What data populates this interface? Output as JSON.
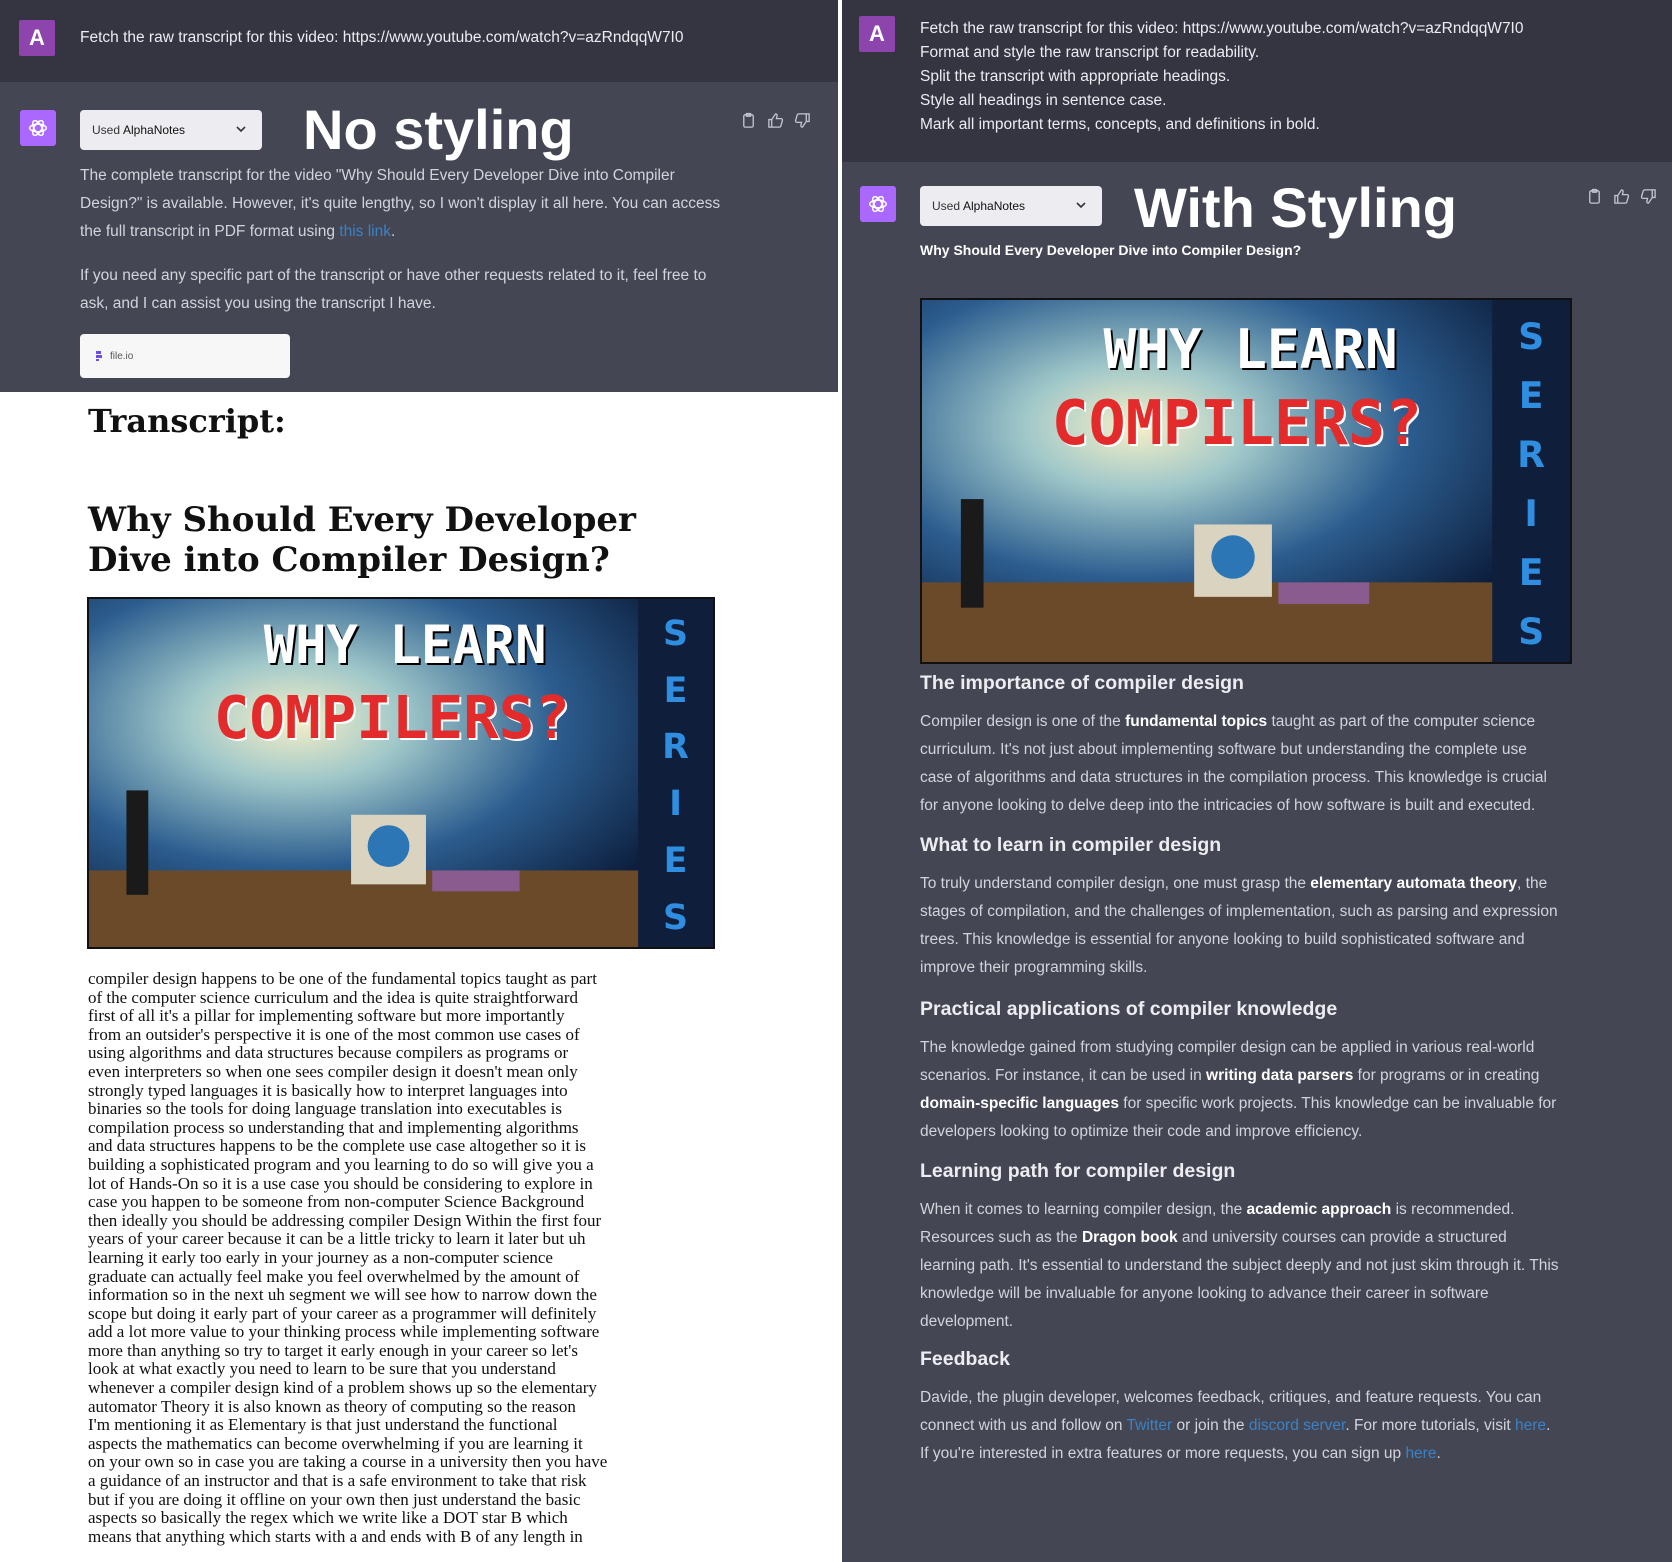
{
  "left": {
    "user_avatar_letter": "A",
    "user_message": "Fetch the raw transcript for this video: https://www.youtube.com/watch?v=azRndqqW7I0",
    "plugin_used_prefix": "Used ",
    "plugin_name": "AlphaNotes",
    "overlay_label": "No styling",
    "reply_p1_a": "The complete transcript for the video \"Why Should Every Developer Dive into Compiler Design?\" is available. However, it's quite lengthy, so I won't display it all here. You can access the full transcript in PDF format using ",
    "reply_p1_link": "this link",
    "reply_p1_b": ".",
    "reply_p2": "If you need any specific part of the transcript or have other requests related to it, feel free to ask, and I can assist you using the transcript I have.",
    "file_card_label": "file.io",
    "doc": {
      "heading": "Transcript:",
      "title": "Why Should Every Developer Dive into Compiler Design?",
      "thumb_line1": "WHY LEARN",
      "thumb_line2": "COMPILERS?",
      "thumb_series": "SERIES",
      "body": "compiler design happens to be one of the  fundamental topics taught as part\nof the   computer science curriculum and the idea is quite  straightforward\nfirst of all it's a pillar for   implementing software but more importantly\nfrom  an outsider's perspective it is one of the most   common use cases of\nusing algorithms and data  structures because compilers as programs or\neven interpreters so when one sees compiler  design it doesn't mean only\nstrongly typed   languages it is basically how to interpret  languages into\nbinaries so the tools for   doing language translation into executables  is\ncompilation process so understanding that   and implementing algorithms\nand data structures  happens to be the complete use case altogether   so it is\nbuilding a sophisticated program and you  learning to do so will give you a\nlot of Hands-On   so it is a use case you should be considering  to explore in\ncase you happen to be someone   from non-computer Science Background\nthen ideally  you should be addressing compiler Design Within   the first four\nyears of your career because it  can be a little tricky to learn it later but   uh\nlearning it early too early in your  journey as a non-computer science\ngraduate   can actually feel make you feel overwhelmed  by the amount of\ninformation so in the next   uh segment we will see how to narrow down  the\nscope but doing it early part of your   career as a programmer will definitely\nadd a  lot more value to your thinking process while   implementing software\nmore than anything so  try to target it early enough in your career so let's\nlook at what exactly you need to  learn to be sure that you understand\nwhenever   a compiler design kind of a problem shows up  so the elementary\nautomator Theory it is also   known as theory of computing so the reason\nI'm mentioning it as Elementary is that just   understand the functional\naspects the mathematics  can become overwhelming if you are learning it\non your own so in case you are taking a course  in a university then you have\na guidance of an   instructor and that is a safe environment to take  that risk\nbut if you are doing it offline on your   own then just understand the basic\naspects so  basically the regex which we write like a DOT   star B which\nmeans that anything which starts  with a and ends with B of any length in"
    }
  },
  "right": {
    "user_avatar_letter": "A",
    "user_lines": [
      "Fetch the raw transcript for this video: https://www.youtube.com/watch?v=azRndqqW7I0",
      "Format and style the raw transcript for readability.",
      "Split the transcript with appropriate headings.",
      "Style all headings in sentence case.",
      "Mark all important terms, concepts, and definitions in bold."
    ],
    "plugin_used_prefix": "Used ",
    "plugin_name": "AlphaNotes",
    "overlay_label": "With Styling",
    "title": "Why Should Every Developer Dive into Compiler Design?",
    "thumb_line1": "WHY LEARN",
    "thumb_line2": "COMPILERS?",
    "thumb_series": "SERIES",
    "sections": [
      {
        "heading": "The importance of compiler design",
        "parts": [
          {
            "t": "Compiler design is one of the "
          },
          {
            "t": "fundamental topics",
            "b": true
          },
          {
            "t": " taught as part of the computer science curriculum. It's not just about implementing software but understanding the complete use case of algorithms and data structures in the compilation process. This knowledge is crucial for anyone looking to delve deep into the intricacies of how software is built and executed."
          }
        ]
      },
      {
        "heading": "What to learn in compiler design",
        "parts": [
          {
            "t": "To truly understand compiler design, one must grasp the "
          },
          {
            "t": "elementary automata theory",
            "b": true
          },
          {
            "t": ", the stages of compilation, and the challenges of implementation, such as parsing and expression trees. This knowledge is essential for anyone looking to build sophisticated software and improve their programming skills."
          }
        ]
      },
      {
        "heading": "Practical applications of compiler knowledge",
        "parts": [
          {
            "t": "The knowledge gained from studying compiler design can be applied in various real-world scenarios. For instance, it can be used in "
          },
          {
            "t": "writing data parsers",
            "b": true
          },
          {
            "t": " for programs or in creating "
          },
          {
            "t": "domain-specific languages",
            "b": true
          },
          {
            "t": " for specific work projects. This knowledge can be invaluable for developers looking to optimize their code and improve efficiency."
          }
        ]
      },
      {
        "heading": "Learning path for compiler design",
        "parts": [
          {
            "t": "When it comes to learning compiler design, the "
          },
          {
            "t": "academic approach",
            "b": true
          },
          {
            "t": " is recommended. Resources such as the "
          },
          {
            "t": "Dragon book",
            "b": true
          },
          {
            "t": " and university courses can provide a structured learning path. It's essential to understand the subject deeply and not just skim through it. This knowledge will be invaluable for anyone looking to advance their career in software development."
          }
        ]
      },
      {
        "heading": "Feedback",
        "parts": [
          {
            "t": "Davide, the plugin developer, welcomes feedback, critiques, and feature requests. You can connect with us and follow on "
          },
          {
            "t": "Twitter",
            "link": true
          },
          {
            "t": " or join the "
          },
          {
            "t": "discord server",
            "link": true
          },
          {
            "t": ". For more tutorials, visit "
          },
          {
            "t": "here",
            "link": true
          },
          {
            "t": ". If you're interested in extra features or more requests, you can sign up "
          },
          {
            "t": "here",
            "link": true
          },
          {
            "t": "."
          }
        ]
      }
    ]
  },
  "icons": [
    "openai-icon",
    "chevron-down-icon",
    "clipboard-icon",
    "thumbs-up-icon",
    "thumbs-down-icon",
    "file-io-icon"
  ],
  "colors": {
    "user_bg": "#343541",
    "assistant_bg": "#444654",
    "avatar_user": "#8e44ad",
    "avatar_gpt": "#ab68ff",
    "link": "#3b82c4"
  }
}
